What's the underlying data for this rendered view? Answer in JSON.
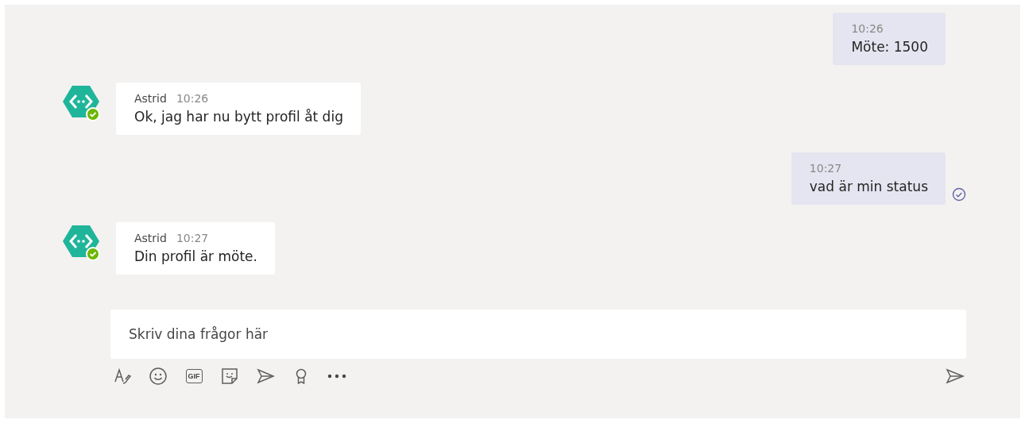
{
  "messages": [
    {
      "kind": "outgoing",
      "time": "10:26",
      "text": "Möte: 1500",
      "seen": false
    },
    {
      "kind": "incoming",
      "author": "Astrid",
      "time": "10:26",
      "text": "Ok, jag har nu bytt profil åt dig"
    },
    {
      "kind": "outgoing",
      "time": "10:27",
      "text": "vad är min status",
      "seen": true
    },
    {
      "kind": "incoming",
      "author": "Astrid",
      "time": "10:27",
      "text": "Din profil är möte."
    }
  ],
  "composer": {
    "placeholder": "Skriv dina frågor här"
  },
  "toolbar": [
    {
      "kind": "format"
    },
    {
      "kind": "emoji"
    },
    {
      "kind": "gif",
      "label": "GIF"
    },
    {
      "kind": "sticker"
    },
    {
      "kind": "send-later"
    },
    {
      "kind": "praise"
    },
    {
      "kind": "more"
    }
  ]
}
